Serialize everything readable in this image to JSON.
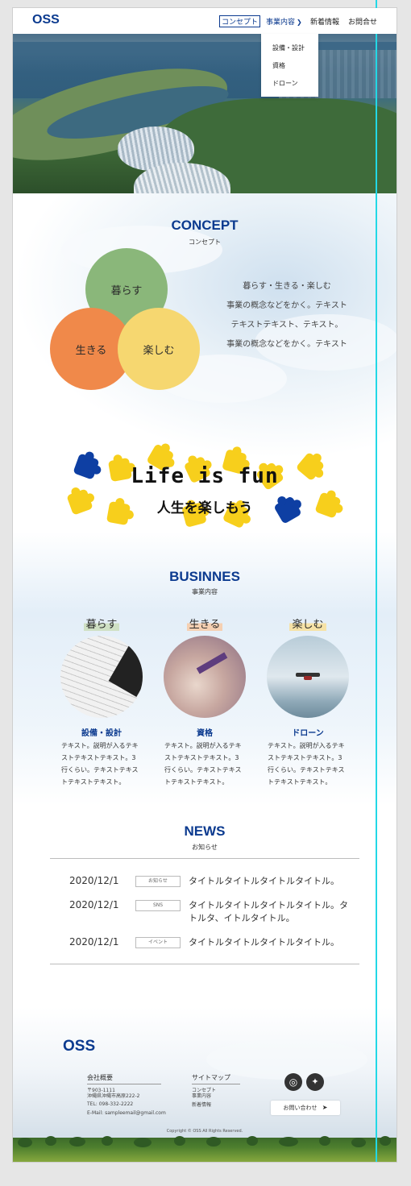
{
  "header": {
    "logo": "OSS",
    "nav": {
      "concept": "コンセプト",
      "business": "事業内容",
      "news": "新着情報",
      "contact": "お問合せ"
    },
    "dropdown": [
      "設備・設計",
      "資格",
      "ドローン"
    ]
  },
  "concept": {
    "title": "CONCEPT",
    "subtitle": "コンセプト",
    "circles": [
      "暮らす",
      "生きる",
      "楽しむ"
    ],
    "text": [
      "暮らす・生きる・楽しむ",
      "事業の概念などをかく。テキスト",
      "テキストテキスト、テキスト。",
      "事業の概念などをかく。テキスト"
    ]
  },
  "lifeisfun": {
    "main": "Life is fun",
    "sub": "人生を楽しもう"
  },
  "business": {
    "title": "BUSINNES",
    "subtitle": "事業内容",
    "items": [
      {
        "head": "暮らす",
        "name": "設備・設計",
        "desc": "テキスト。説明が入るテキストテキストテキスト。3行くらい。テキストテキストテキストテキスト。"
      },
      {
        "head": "生きる",
        "name": "資格",
        "desc": "テキスト。説明が入るテキストテキストテキスト。3行くらい。テキストテキストテキストテキスト。"
      },
      {
        "head": "楽しむ",
        "name": "ドローン",
        "desc": "テキスト。説明が入るテキストテキストテキスト。3行くらい。テキストテキストテキストテキスト。"
      }
    ]
  },
  "news": {
    "title": "NEWS",
    "subtitle": "お知らせ",
    "items": [
      {
        "date": "2020/12/1",
        "tag": "お知らせ",
        "title": "タイトルタイトルタイトルタイトル。"
      },
      {
        "date": "2020/12/1",
        "tag": "SNS",
        "title": "タイトルタイトルタイトルタイトル。タトルタ、イトルタイトル。"
      },
      {
        "date": "2020/12/1",
        "tag": "イベント",
        "title": "タイトルタイトルタイトルタイトル。"
      }
    ]
  },
  "footer": {
    "logo": "OSS",
    "company_head": "会社概要",
    "postal": "〒903-1111",
    "address": "沖縄県沖縄市高原222-2",
    "tel": "TEL: 098-332-2222",
    "email": "E-Mail: sampleemail@gmail.com",
    "sitemap_head": "サイトマップ",
    "sitemap": [
      "コンセプト",
      "事業内容",
      "新着情報"
    ],
    "contact_button": "お問い合わせ",
    "copyright": "Copyright © OSS All Rights Reserved."
  },
  "colors": {
    "brand": "#0b3a8f",
    "circle_green": "#8ab77a",
    "circle_orange": "#f0894a",
    "circle_yellow": "#f6d770",
    "puzzle_yellow": "#f7cf1c",
    "puzzle_blue": "#0e3fa3"
  }
}
